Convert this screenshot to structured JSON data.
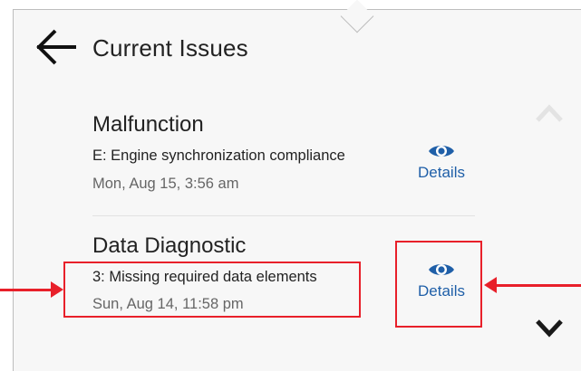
{
  "header": {
    "title": "Current Issues",
    "back_icon": "arrow-left-icon"
  },
  "issues": [
    {
      "type": "Malfunction",
      "code": "E: Engine synchronization compliance",
      "timestamp": "Mon, Aug 15, 3:56 am",
      "action_label": "Details",
      "action_icon": "eye-icon"
    },
    {
      "type": "Data Diagnostic",
      "code": "3: Missing required data elements",
      "timestamp": "Sun, Aug 14, 11:58 pm",
      "action_label": "Details",
      "action_icon": "eye-icon"
    }
  ],
  "scroll": {
    "up_icon": "chevron-up-icon",
    "down_icon": "chevron-down-icon"
  },
  "colors": {
    "panel_bg": "#f7f7f7",
    "link_blue": "#1f5fa8",
    "highlight_red": "#e8202a",
    "text_dark": "#222222",
    "text_muted": "#666666"
  }
}
